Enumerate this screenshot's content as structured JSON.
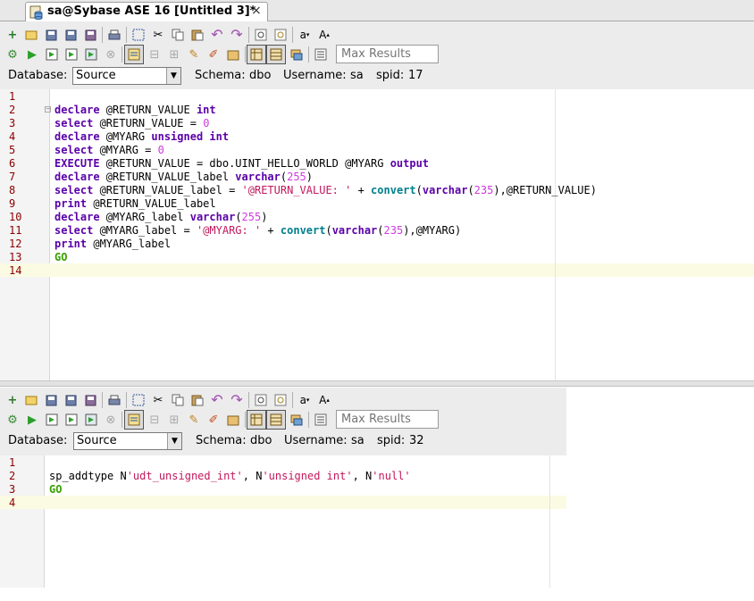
{
  "tab": {
    "title": "sa@Sybase ASE 16 [Untitled 3]*",
    "close": "×",
    "icon": "database-icon"
  },
  "top": {
    "max_results_placeholder": "Max Results",
    "database_label": "Database:",
    "database_value": "Source",
    "schema_label": "Schema:",
    "schema_value": "dbo",
    "username_label": "Username:",
    "username_value": "sa",
    "spid_label": "spid:",
    "spid_value": "17",
    "lines": [
      "1",
      "2",
      "3",
      "4",
      "5",
      "6",
      "7",
      "8",
      "9",
      "10",
      "11",
      "12",
      "13",
      "14"
    ],
    "code": [
      "",
      [
        [
          "kw",
          "declare"
        ],
        [
          "p",
          " @RETURN_VALUE "
        ],
        [
          "kw",
          "int"
        ]
      ],
      [
        [
          "kw",
          "select"
        ],
        [
          "p",
          " @RETURN_VALUE = "
        ],
        [
          "num",
          "0"
        ]
      ],
      [
        [
          "kw",
          "declare"
        ],
        [
          "p",
          " @MYARG "
        ],
        [
          "kw",
          "unsigned int"
        ]
      ],
      [
        [
          "kw",
          "select"
        ],
        [
          "p",
          " @MYARG = "
        ],
        [
          "num",
          "0"
        ]
      ],
      [
        [
          "kw",
          "EXECUTE"
        ],
        [
          "p",
          " @RETURN_VALUE = dbo.UINT_HELLO_WORLD @MYARG "
        ],
        [
          "kw",
          "output"
        ]
      ],
      [
        [
          "kw",
          "declare"
        ],
        [
          "p",
          " @RETURN_VALUE_label "
        ],
        [
          "kw",
          "varchar"
        ],
        [
          "p",
          "("
        ],
        [
          "num",
          "255"
        ],
        [
          "p",
          ")"
        ]
      ],
      [
        [
          "kw",
          "select"
        ],
        [
          "p",
          " @RETURN_VALUE_label = "
        ],
        [
          "str",
          "'@RETURN_VALUE: '"
        ],
        [
          "p",
          " + "
        ],
        [
          "fn",
          "convert"
        ],
        [
          "p",
          "("
        ],
        [
          "kw",
          "varchar"
        ],
        [
          "p",
          "("
        ],
        [
          "num",
          "235"
        ],
        [
          "p",
          "),@RETURN_VALUE)"
        ]
      ],
      [
        [
          "kw",
          "print"
        ],
        [
          "p",
          " @RETURN_VALUE_label"
        ]
      ],
      [
        [
          "kw",
          "declare"
        ],
        [
          "p",
          " @MYARG_label "
        ],
        [
          "kw",
          "varchar"
        ],
        [
          "p",
          "("
        ],
        [
          "num",
          "255"
        ],
        [
          "p",
          ")"
        ]
      ],
      [
        [
          "kw",
          "select"
        ],
        [
          "p",
          " @MYARG_label = "
        ],
        [
          "str",
          "'@MYARG: '"
        ],
        [
          "p",
          " + "
        ],
        [
          "fn",
          "convert"
        ],
        [
          "p",
          "("
        ],
        [
          "kw",
          "varchar"
        ],
        [
          "p",
          "("
        ],
        [
          "num",
          "235"
        ],
        [
          "p",
          "),@MYARG)"
        ]
      ],
      [
        [
          "kw",
          "print"
        ],
        [
          "p",
          " @MYARG_label"
        ]
      ],
      [
        [
          "go",
          "GO"
        ]
      ],
      ""
    ]
  },
  "bottom": {
    "max_results_placeholder": "Max Results",
    "database_label": "Database:",
    "database_value": "Source",
    "schema_label": "Schema:",
    "schema_value": "dbo",
    "username_label": "Username:",
    "username_value": "sa",
    "spid_label": "spid:",
    "spid_value": "32",
    "lines": [
      "1",
      "2",
      "3",
      "4"
    ],
    "code": [
      "",
      [
        [
          "p",
          "sp_addtype N"
        ],
        [
          "str",
          "'udt_unsigned_int'"
        ],
        [
          "p",
          ", N"
        ],
        [
          "str",
          "'unsigned int'"
        ],
        [
          "p",
          ", N"
        ],
        [
          "str",
          "'null'"
        ]
      ],
      [
        [
          "go",
          "GO"
        ]
      ],
      ""
    ]
  },
  "toolbar_icons": {
    "row1": [
      "new-icon",
      "open-icon",
      "save-icon",
      "save-as-icon",
      "save-all-icon",
      "print-icon",
      "select-all-icon",
      "cut-icon",
      "copy-icon",
      "paste-icon",
      "undo-icon",
      "redo-icon",
      "find-icon",
      "find-replace-icon",
      "lowercase-icon",
      "uppercase-icon"
    ],
    "row2": [
      "settings-icon",
      "execute-icon",
      "execute-step-icon",
      "execute-selection-icon",
      "execute-script-icon",
      "stop-icon",
      "format-icon",
      "comment-icon",
      "uncomment-icon",
      "clear-icon",
      "explain-icon",
      "history-icon",
      "results-grid-icon",
      "results-text-icon",
      "export-icon",
      "options-icon"
    ]
  },
  "colors": {
    "keyword": "#5a00a8",
    "number": "#d03adf",
    "string": "#c2185b",
    "function": "#00808c",
    "go": "#3aa000",
    "linenum": "#8b0000",
    "current_line": "#fbfbe3"
  }
}
